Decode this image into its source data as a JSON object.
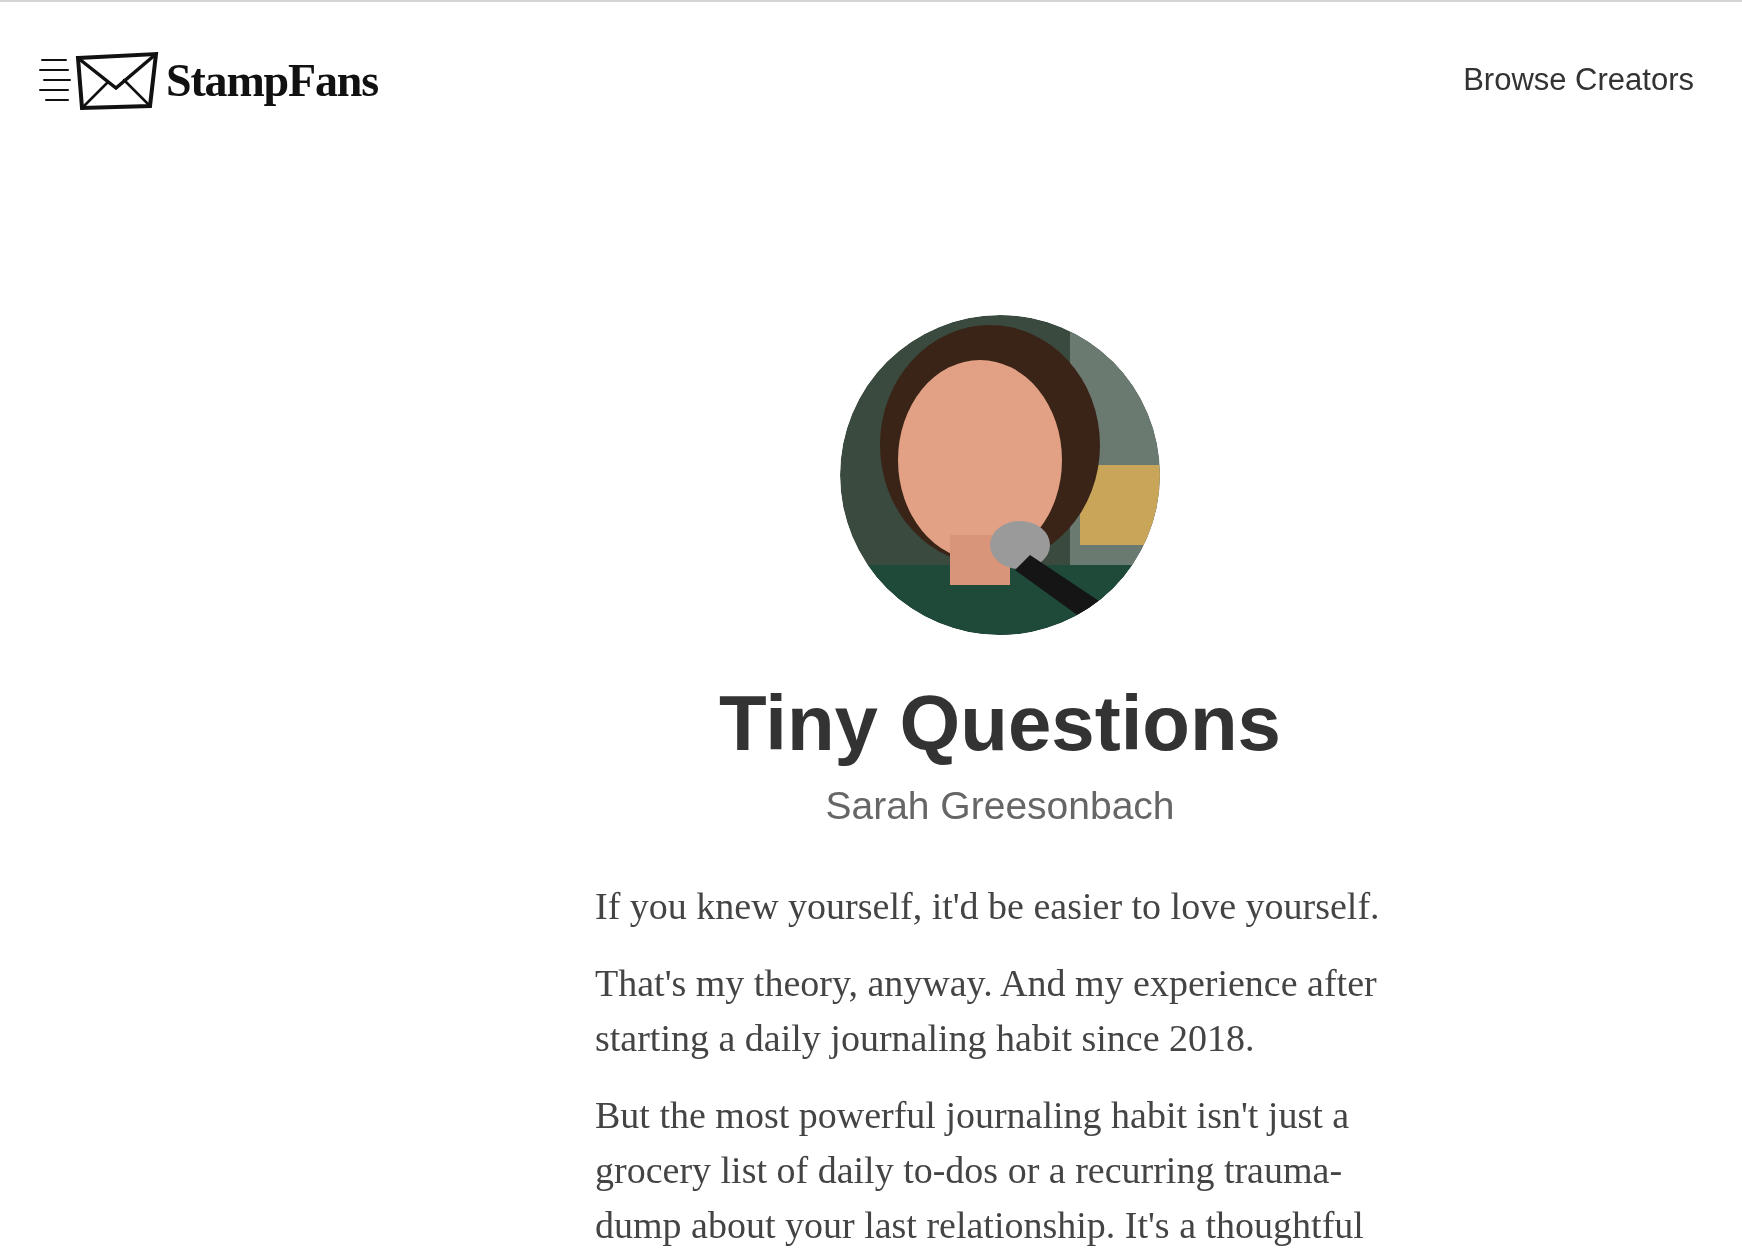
{
  "header": {
    "logo_text": "StampFans",
    "nav_link": "Browse Creators"
  },
  "profile": {
    "title": "Tiny Questions",
    "creator": "Sarah Greesonbach"
  },
  "description": [
    "If you knew yourself, it'd be easier to love yourself.",
    "That's my theory, anyway. And my experience after starting a daily journaling habit since 2018.",
    "But the most powerful journaling habit isn't just a grocery list of daily to-dos or a recurring trauma-dump about your last relationship. It's a thoughtful"
  ]
}
